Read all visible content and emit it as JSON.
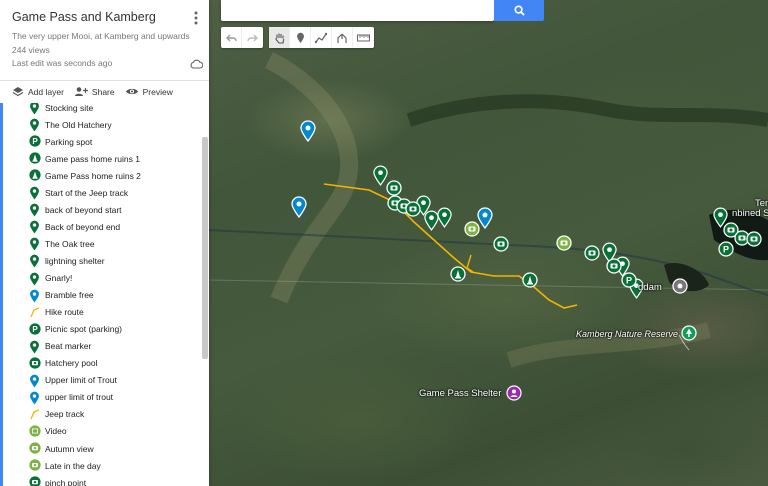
{
  "map": {
    "title": "Game Pass and Kamberg",
    "description": "The very upper Mooi, at Kamberg and upwards",
    "views": "244 views",
    "last_edit": "Last edit was seconds ago"
  },
  "actions": {
    "add_layer": "Add layer",
    "share": "Share",
    "preview": "Preview"
  },
  "items": [
    {
      "label": "Stocking site",
      "icon": "pin-green"
    },
    {
      "label": "The Old Hatchery",
      "icon": "pin-green"
    },
    {
      "label": "Parking spot",
      "icon": "parking-green"
    },
    {
      "label": "Game pass home ruins 1",
      "icon": "monument-green"
    },
    {
      "label": "Game Pass home ruins 2",
      "icon": "monument-green"
    },
    {
      "label": "Start of the Jeep track",
      "icon": "pin-green"
    },
    {
      "label": "back of beyond start",
      "icon": "pin-green"
    },
    {
      "label": "Back of beyond end",
      "icon": "pin-green"
    },
    {
      "label": "The Oak tree",
      "icon": "pin-green"
    },
    {
      "label": "lightning shelter",
      "icon": "pin-green"
    },
    {
      "label": "Gnarly!",
      "icon": "pin-green"
    },
    {
      "label": "Bramble free",
      "icon": "pin-blue"
    },
    {
      "label": "Hike route",
      "icon": "line-yellow"
    },
    {
      "label": "Picnic spot (parking)",
      "icon": "parking-green"
    },
    {
      "label": "Beat marker",
      "icon": "pin-green"
    },
    {
      "label": "Hatchery pool",
      "icon": "camera-green"
    },
    {
      "label": "Upper limit of Trout",
      "icon": "pin-blue"
    },
    {
      "label": "upper limit of trout",
      "icon": "pin-blue"
    },
    {
      "label": "Jeep track",
      "icon": "line-yellow"
    },
    {
      "label": "Video",
      "icon": "video-olive"
    },
    {
      "label": "Autumn view",
      "icon": "camera-olive"
    },
    {
      "label": "Late in the day",
      "icon": "camera-olive"
    },
    {
      "label": "pinch point",
      "icon": "camera-green"
    }
  ],
  "map_labels": {
    "reserve": "Kamberg Nature Reserve",
    "shelter": "Game Pass Shelter",
    "dam": "ddam",
    "edge_1": "Ten",
    "edge_2": "nbined Sc"
  },
  "colors": {
    "marker_green": "#0f9d58",
    "marker_dark_green": "#097138",
    "marker_blue": "#0288d1",
    "marker_olive": "#7cb342",
    "route_yellow": "#f4b400",
    "shelter_purple": "#9c27b0",
    "search_blue": "#4285f4"
  }
}
